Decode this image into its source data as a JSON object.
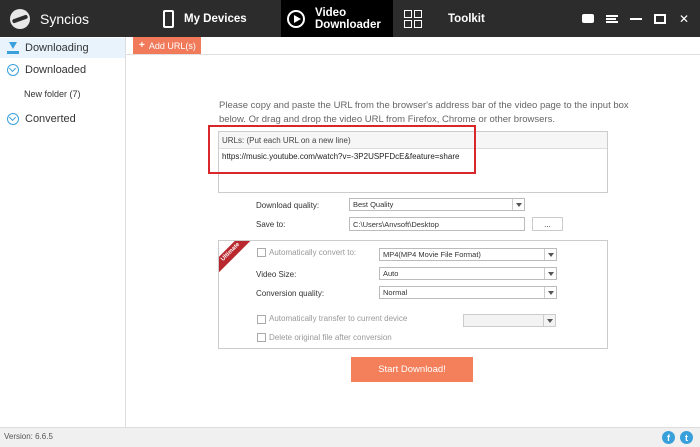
{
  "app": {
    "name": "Syncios"
  },
  "nav": {
    "devices": "My Devices",
    "video": "Video Downloader",
    "toolkit": "Toolkit"
  },
  "sidebar": {
    "downloading": "Downloading",
    "downloaded": "Downloaded",
    "new_folder": "New folder (7)",
    "converted": "Converted"
  },
  "toolbar": {
    "add_url": "Add URL(s)"
  },
  "instructions": "Please copy and paste the URL from the browser's address bar of the video page to the input box below. Or drag and drop the video URL from Firefox, Chrome or other browsers.",
  "urlbox": {
    "header": "URLs: (Put each URL on a new line)",
    "value": "https://music.youtube.com/watch?v=-3P2USPFDcE&feature=share"
  },
  "settings": {
    "quality_label": "Download quality:",
    "quality_value": "Best Quality",
    "save_label": "Save to:",
    "save_value": "C:\\Users\\Anvsoft\\Desktop",
    "browse": "..."
  },
  "options": {
    "ribbon": "Ultimate",
    "auto_convert": "Automatically convert to:",
    "format_value": "MP4(MP4 Movie File Format)",
    "video_size_label": "Video Size:",
    "video_size_value": "Auto",
    "conv_quality_label": "Conversion quality:",
    "conv_quality_value": "Normal",
    "auto_transfer": "Automatically transfer to current device",
    "delete_orig": "Delete original file after conversion"
  },
  "start_button": "Start Download!",
  "footer": {
    "version": "Version: 6.6.5"
  },
  "colors": {
    "accent": "#f37f5b",
    "blue": "#3aa0db",
    "highlight": "#d8262b"
  }
}
